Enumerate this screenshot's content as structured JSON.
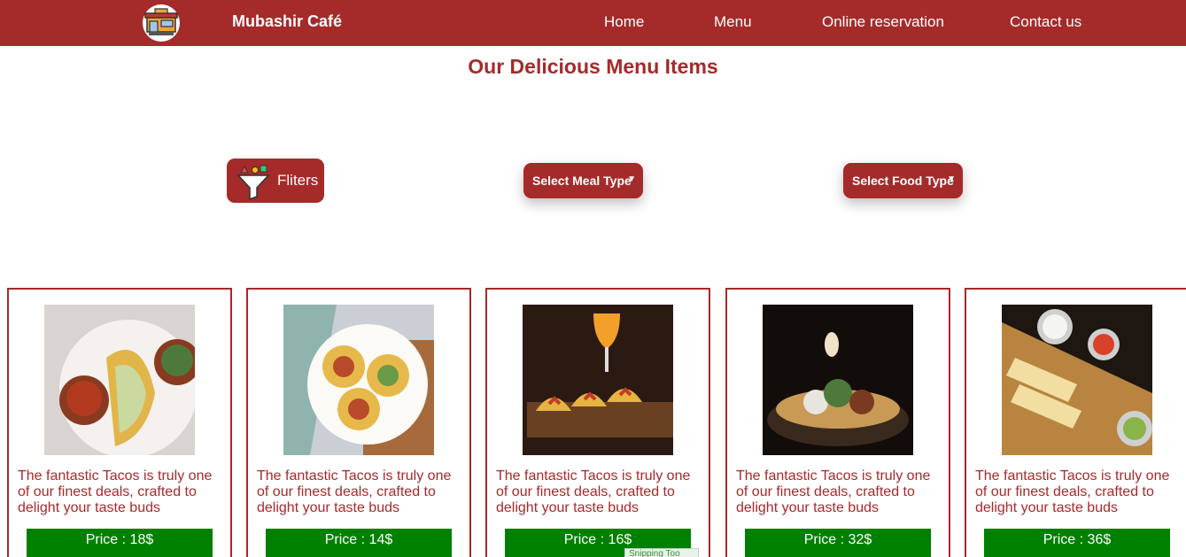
{
  "navbar": {
    "brand": "Mubashir Café",
    "links": [
      "Home",
      "Menu",
      "Online reservation",
      "Contact us"
    ],
    "bg_color": "#a52a2a"
  },
  "page": {
    "title": "Our Delicious Menu Items"
  },
  "filters": {
    "button_label": "Fliters",
    "meal_type": "Select Meal Type",
    "food_type": "Select Food Type"
  },
  "cards": [
    {
      "description": "The fantastic Tacos is truly one of our finest deals, crafted to delight your taste buds",
      "price": "Price : 18$"
    },
    {
      "description": "The fantastic Tacos is truly one of our finest deals, crafted to delight your taste buds",
      "price": "Price : 14$"
    },
    {
      "description": "The fantastic Tacos is truly one of our finest deals, crafted to delight your taste buds",
      "price": "Price : 16$"
    },
    {
      "description": "The fantastic Tacos is truly one of our finest deals, crafted to delight your taste buds",
      "price": "Price : 32$"
    },
    {
      "description": "The fantastic Tacos is truly one of our finest deals, crafted to delight your taste buds",
      "price": "Price : 36$"
    }
  ],
  "overlay": {
    "snipping_label": "Snipping Too"
  },
  "colors": {
    "accent": "#a52a2a",
    "price_bg": "#008000"
  }
}
